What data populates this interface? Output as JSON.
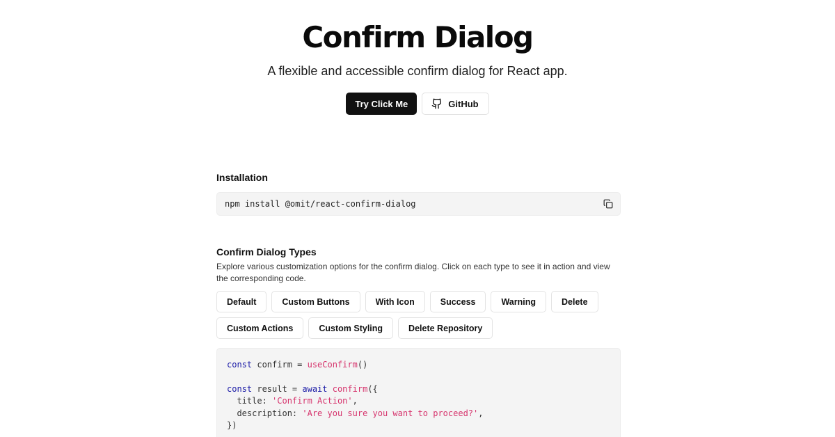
{
  "hero": {
    "title": "Confirm Dialog",
    "subtitle": "A flexible and accessible confirm dialog for React app.",
    "primary_button": "Try Click Me",
    "github_button": "GitHub"
  },
  "installation": {
    "title": "Installation",
    "command": "npm install @omit/react-confirm-dialog",
    "copy_icon": "copy-icon"
  },
  "types": {
    "title": "Confirm Dialog Types",
    "description": "Explore various customization options for the confirm dialog. Click on each type to see it in action and view the corresponding code.",
    "buttons": [
      "Default",
      "Custom Buttons",
      "With Icon",
      "Success",
      "Warning",
      "Delete",
      "Custom Actions",
      "Custom Styling",
      "Delete Repository"
    ]
  },
  "code": {
    "l1_kw": "const",
    "l1_var": " confirm = ",
    "l1_fn": "useConfirm",
    "l1_end": "()",
    "l2_kw": "const",
    "l2_var": " result = ",
    "l2_kw2": "await",
    "l2_fn": "confirm",
    "l2_end": "({",
    "l3_key": "  title: ",
    "l3_str": "'Confirm Action'",
    "l3_end": ",",
    "l4_key": "  description: ",
    "l4_str": "'Are you sure you want to proceed?'",
    "l4_end": ",",
    "l5": "})"
  },
  "colors": {
    "primary": "#111111",
    "keyword": "#1a1aa6",
    "string": "#d6336c",
    "code_bg": "#f4f4f4"
  }
}
